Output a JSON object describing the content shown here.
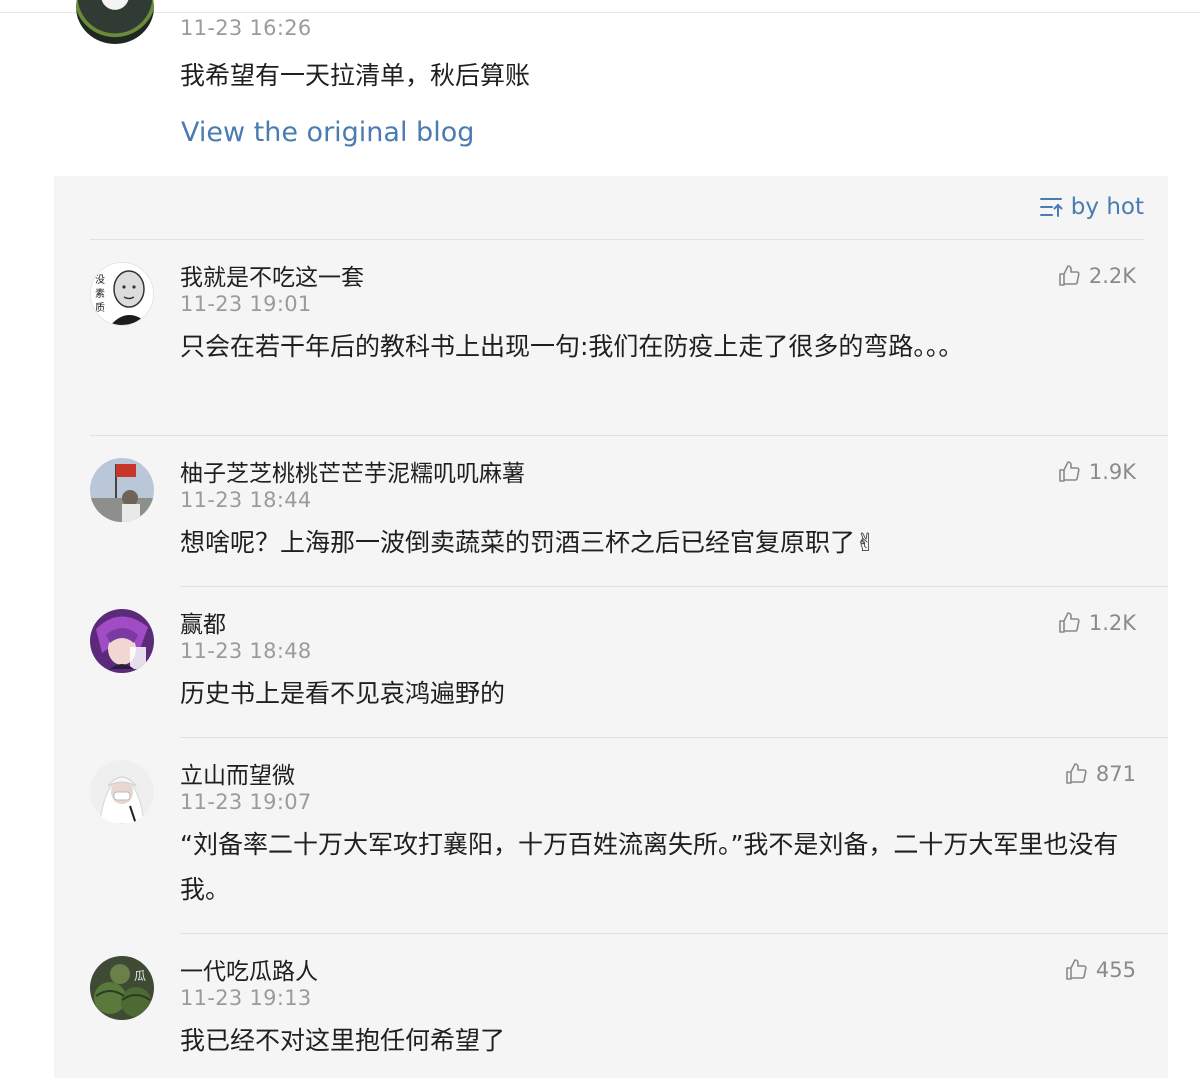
{
  "post": {
    "time": "11-23 16:26",
    "text": "我希望有一天拉清单，秋后算账",
    "view_original_label": "View the original blog"
  },
  "comments_panel": {
    "sort_label": "by hot",
    "sort_icon": "sort-lines-icon"
  },
  "comments": [
    {
      "name": "我就是不吃这一套",
      "time": "11-23 19:01",
      "text": "只会在若干年后的教科书上出现一句:我们在防疫上走了很多的弯路。。。",
      "likes": "2.2K"
    },
    {
      "name": "柚子芝芝桃桃芒芒芋泥糯叽叽麻薯",
      "time": "11-23 18:44",
      "text": "想啥呢？上海那一波倒卖蔬菜的罚酒三杯之后已经官复原职了✌",
      "likes": "1.9K"
    },
    {
      "name": "赢都",
      "time": "11-23 18:48",
      "text": "历史书上是看不见哀鸿遍野的",
      "likes": "1.2K"
    },
    {
      "name": "立山而望微",
      "time": "11-23 19:07",
      "text": "“刘备率二十万大军攻打襄阳，十万百姓流离失所。”我不是刘备，二十万大军里也没有我。",
      "likes": "871"
    },
    {
      "name": "一代吃瓜路人",
      "time": "11-23 19:13",
      "text": "我已经不对这里抱任何希望了",
      "likes": "455"
    }
  ],
  "colors": {
    "link": "#4a7cb2",
    "meta": "#9b9b9b",
    "panel_bg": "#f5f5f5"
  }
}
